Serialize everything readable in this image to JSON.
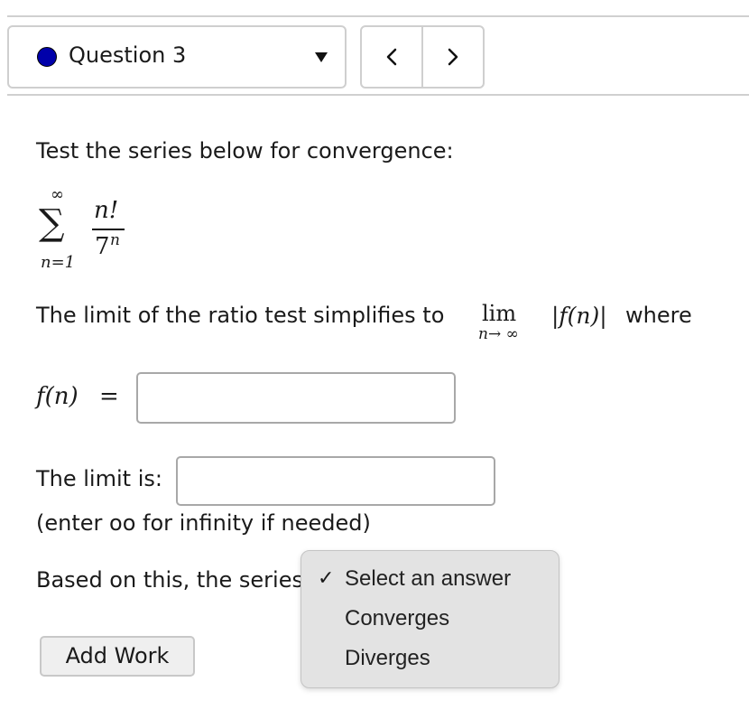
{
  "header": {
    "question_label": "Question 3",
    "dot_color": "#0000aa"
  },
  "nav": {
    "prev_icon": "chevron-left-icon",
    "next_icon": "chevron-right-icon"
  },
  "content": {
    "prompt": "Test the series below for convergence:",
    "series": {
      "upper": "∞",
      "numerator": "n!",
      "denominator_base": "7",
      "denominator_exp": "n",
      "lower": "n=1",
      "sigma": "∑"
    },
    "ratio_text": "The limit of the ratio test simplifies to",
    "lim_word": "lim",
    "lim_sub": "n→ ∞",
    "abs_expr": "|f(n)|",
    "where": "where",
    "fn_label": "f(n)",
    "equals": "=",
    "fn_value": "",
    "limit_label": "The limit is:",
    "limit_value": "",
    "hint": "(enter oo for infinity if needed)",
    "based_text": "Based on this, the series"
  },
  "dropdown": {
    "checkmark": "✓",
    "options": [
      "Select an answer",
      "Converges",
      "Diverges"
    ],
    "selected": "Select an answer"
  },
  "buttons": {
    "add_work": "Add Work"
  }
}
